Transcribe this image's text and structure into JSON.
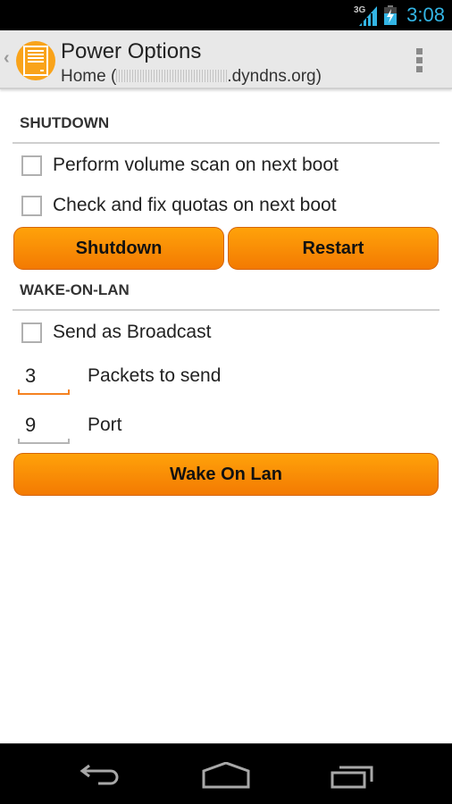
{
  "status_bar": {
    "network": "3G",
    "time": "3:08",
    "icons": [
      "signal-icon",
      "battery-charging-icon"
    ]
  },
  "action_bar": {
    "title": "Power Options",
    "subtitle_prefix": "Home (",
    "subtitle_suffix": ".dyndns.org)",
    "icons": [
      "up-caret-icon",
      "server-icon",
      "overflow-menu-icon"
    ]
  },
  "shutdown": {
    "header": "SHUTDOWN",
    "options": [
      {
        "label": "Perform volume scan on next boot",
        "checked": false
      },
      {
        "label": "Check and fix quotas on next boot",
        "checked": false
      }
    ],
    "shutdown_button": "Shutdown",
    "restart_button": "Restart"
  },
  "wol": {
    "header": "WAKE-ON-LAN",
    "broadcast": {
      "label": "Send as Broadcast",
      "checked": false
    },
    "packets": {
      "value": "3",
      "label": "Packets to send"
    },
    "port": {
      "value": "9",
      "label": "Port"
    },
    "button": "Wake On Lan"
  },
  "nav_bar": {
    "icons": [
      "back-icon",
      "home-icon",
      "recent-apps-icon"
    ]
  },
  "colors": {
    "accent": "#f58220",
    "button_top": "#ffa20a",
    "button_bottom": "#f37a02",
    "clock": "#33b5e5"
  }
}
